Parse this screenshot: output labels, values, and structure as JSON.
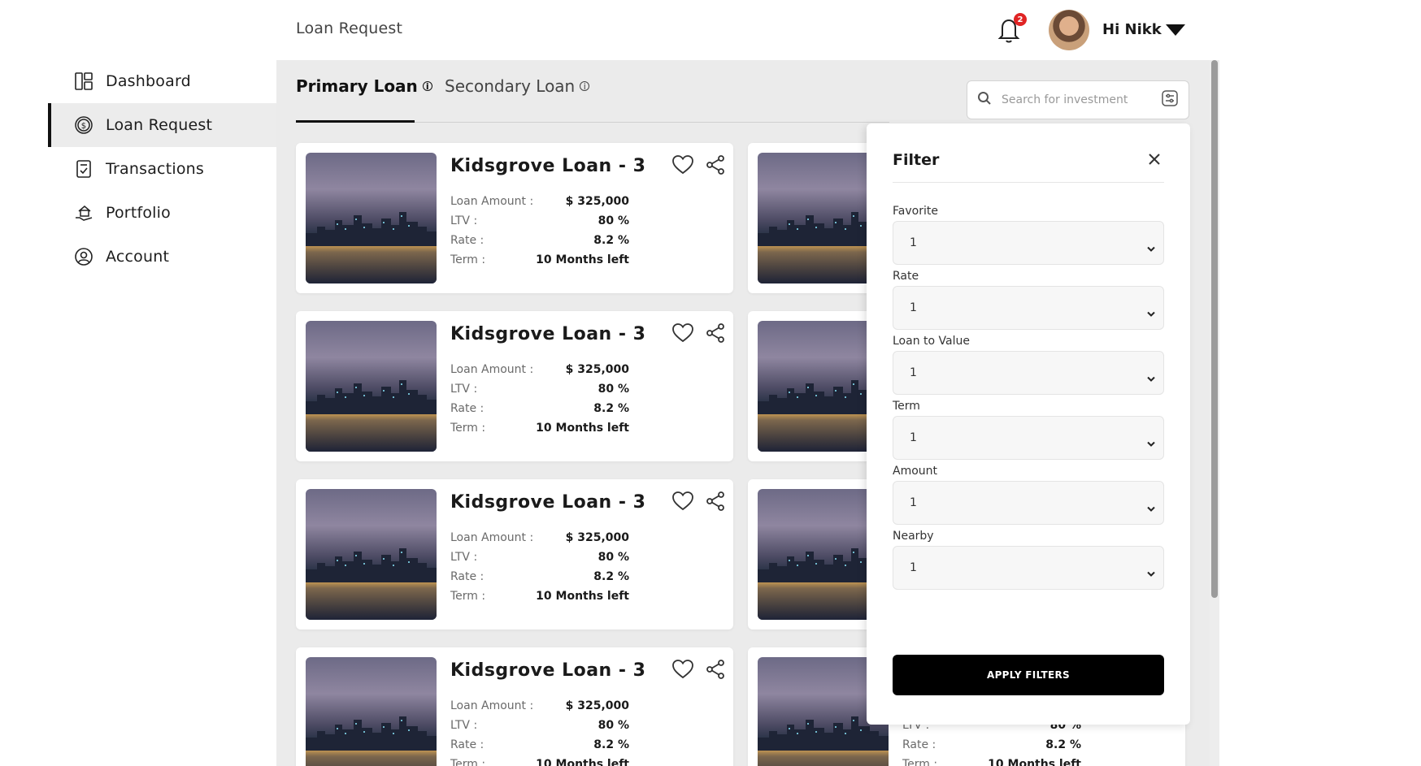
{
  "sidebar": {
    "items": [
      {
        "label": "Dashboard",
        "icon": "dashboard-icon"
      },
      {
        "label": "Loan Request",
        "icon": "dollar-circle-icon",
        "active": true
      },
      {
        "label": "Transactions",
        "icon": "receipt-icon"
      },
      {
        "label": "Portfolio",
        "icon": "hand-house-icon"
      },
      {
        "label": "Account",
        "icon": "user-circle-icon"
      }
    ]
  },
  "header": {
    "title": "Loan Request",
    "notification_count": "2",
    "greeting": "Hi Nikk"
  },
  "tabs": [
    {
      "label": "Primary Loan",
      "info": "i",
      "active": true
    },
    {
      "label": "Secondary Loan",
      "info": "i",
      "active": false
    }
  ],
  "search": {
    "placeholder": "Search for investment"
  },
  "loan_card": {
    "title": "Kidsgrove Loan - 3",
    "amount_label": "Loan Amount :",
    "amount_value": "$ 325,000",
    "ltv_label": "LTV :",
    "ltv_value": "80 %",
    "rate_label": "Rate :",
    "rate_value": "8.2 %",
    "term_label": "Term :",
    "term_value": "10 Months left"
  },
  "filter": {
    "title": "Filter",
    "fields": [
      {
        "label": "Favorite",
        "value": "1"
      },
      {
        "label": "Rate",
        "value": "1"
      },
      {
        "label": "Loan to Value",
        "value": "1"
      },
      {
        "label": "Term",
        "value": "1"
      },
      {
        "label": "Amount",
        "value": "1"
      },
      {
        "label": "Nearby",
        "value": "1"
      }
    ],
    "apply_label": "APPLY FILTERS"
  },
  "colors": {
    "accent": "#000000",
    "badge": "#e02424",
    "main_bg": "#ebebeb"
  }
}
